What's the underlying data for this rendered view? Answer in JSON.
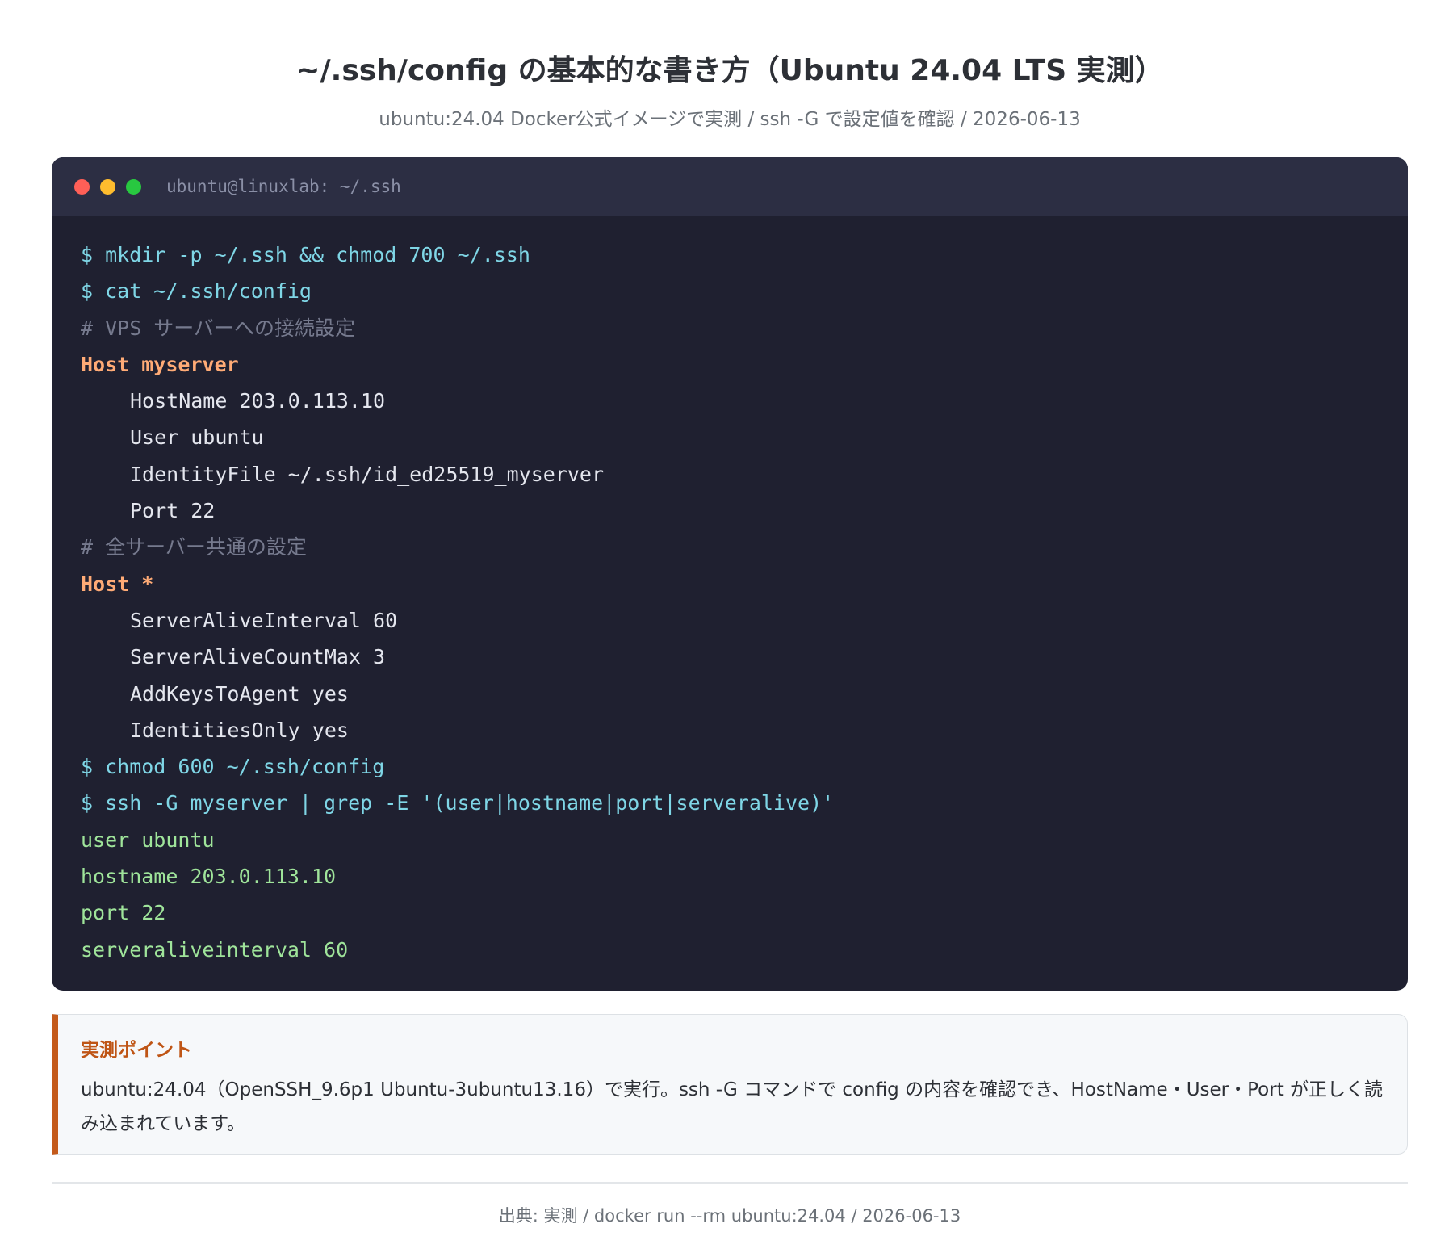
{
  "header": {
    "title": "~/.ssh/config の基本的な書き方（Ubuntu 24.04 LTS 実測）",
    "subtitle": "ubuntu:24.04 Docker公式イメージで実測 / ssh -G で設定値を確認 / 2026-06-13"
  },
  "terminal": {
    "window_title": "ubuntu@linuxlab: ~/.ssh",
    "traffic_lights": [
      "close",
      "minimize",
      "maximize"
    ],
    "colors": {
      "background": "#1f2030",
      "titlebar": "#2c2e43",
      "command": "#7fd6e6",
      "comment": "#767a8e",
      "host": "#ffab76",
      "option": "#e4e6ee",
      "output": "#9fe49a"
    },
    "lines": [
      {
        "type": "cmd",
        "text": "$ mkdir -p ~/.ssh && chmod 700 ~/.ssh"
      },
      {
        "type": "cmd",
        "text": "$ cat ~/.ssh/config"
      },
      {
        "type": "comment",
        "text": "# VPS サーバーへの接続設定"
      },
      {
        "type": "host",
        "text": "Host myserver"
      },
      {
        "type": "opt",
        "text": "HostName 203.0.113.10"
      },
      {
        "type": "opt",
        "text": "User ubuntu"
      },
      {
        "type": "opt",
        "text": "IdentityFile ~/.ssh/id_ed25519_myserver"
      },
      {
        "type": "opt",
        "text": "Port 22"
      },
      {
        "type": "comment",
        "text": "# 全サーバー共通の設定"
      },
      {
        "type": "host",
        "text": "Host *"
      },
      {
        "type": "opt",
        "text": "ServerAliveInterval 60"
      },
      {
        "type": "opt",
        "text": "ServerAliveCountMax 3"
      },
      {
        "type": "opt",
        "text": "AddKeysToAgent yes"
      },
      {
        "type": "opt",
        "text": "IdentitiesOnly yes"
      },
      {
        "type": "cmd",
        "text": "$ chmod 600 ~/.ssh/config"
      },
      {
        "type": "cmd",
        "text": "$ ssh -G myserver | grep -E '(user|hostname|port|serveralive)'"
      },
      {
        "type": "out",
        "text": "user ubuntu"
      },
      {
        "type": "out",
        "text": "hostname 203.0.113.10"
      },
      {
        "type": "out",
        "text": "port 22"
      },
      {
        "type": "out",
        "text": "serveraliveinterval 60"
      }
    ]
  },
  "callout": {
    "heading": "実測ポイント",
    "body": "ubuntu:24.04（OpenSSH_9.6p1 Ubuntu-3ubuntu13.16）で実行。ssh -G コマンドで config の内容を確認でき、HostName・User・Port が正しく読み込まれています。",
    "accent_color": "#c45a1b"
  },
  "footer": {
    "source": "出典: 実測 / docker run --rm ubuntu:24.04 / 2026-06-13"
  }
}
